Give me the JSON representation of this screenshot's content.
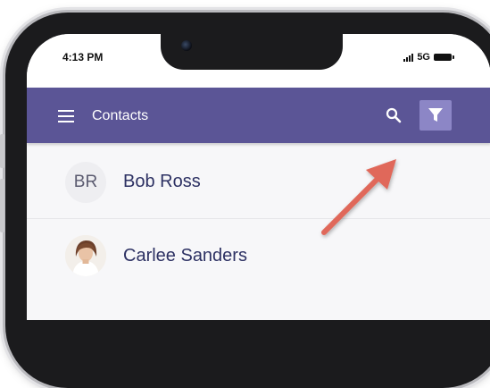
{
  "status_bar": {
    "time": "4:13 PM",
    "network": "5G"
  },
  "app_bar": {
    "title": "Contacts",
    "menu_icon": "hamburger-icon",
    "search_icon": "search-icon",
    "filter_icon": "filter-icon"
  },
  "contacts": [
    {
      "initials": "BR",
      "name": "Bob Ross",
      "avatar": "initials"
    },
    {
      "initials": "",
      "name": "Carlee Sanders",
      "avatar": "photo"
    }
  ],
  "colors": {
    "app_bar": "#5b5596",
    "filter_button": "#8c86c6",
    "contact_name": "#2d3163",
    "annotation_arrow": "#e0685a"
  }
}
